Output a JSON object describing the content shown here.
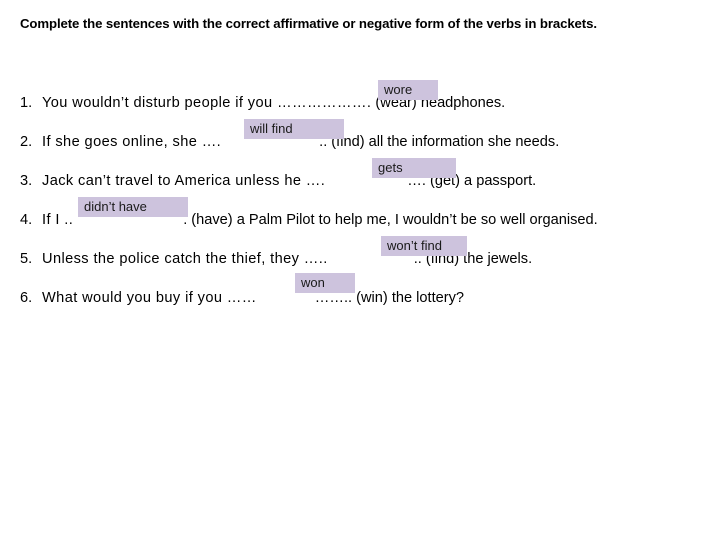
{
  "worksheet": {
    "heading": "Complete the sentences with the correct affirmative or negative form of the verbs in brackets.",
    "highlight_color": "#cdc3dd",
    "items": [
      {
        "number": "1.",
        "text_before": "You wouldn’t disturb people if you ……………….",
        "answer": "wore",
        "text_after": " (wear) headphones."
      },
      {
        "number": "2.",
        "text_before": "If she goes online, she ….",
        "answer": "will find",
        "text_after": ".. (find) all the information she needs."
      },
      {
        "number": "3.",
        "text_before": "Jack can’t travel to America unless he ….",
        "answer": "gets",
        "text_after": "…. (get) a passport."
      },
      {
        "number": "4.",
        "text_before": "If I ..",
        "answer": "didn’t have",
        "text_after": ". (have) a Palm Pilot to help me, I wouldn’t be so well organised."
      },
      {
        "number": "5.",
        "text_before": "Unless the police catch the thief, they …..",
        "answer": "won’t find",
        "text_after": ".. (find) the jewels."
      },
      {
        "number": "6.",
        "text_before": "What would you buy if you ……",
        "answer": "won",
        "text_after": "…….. (win) the lottery?"
      }
    ]
  }
}
